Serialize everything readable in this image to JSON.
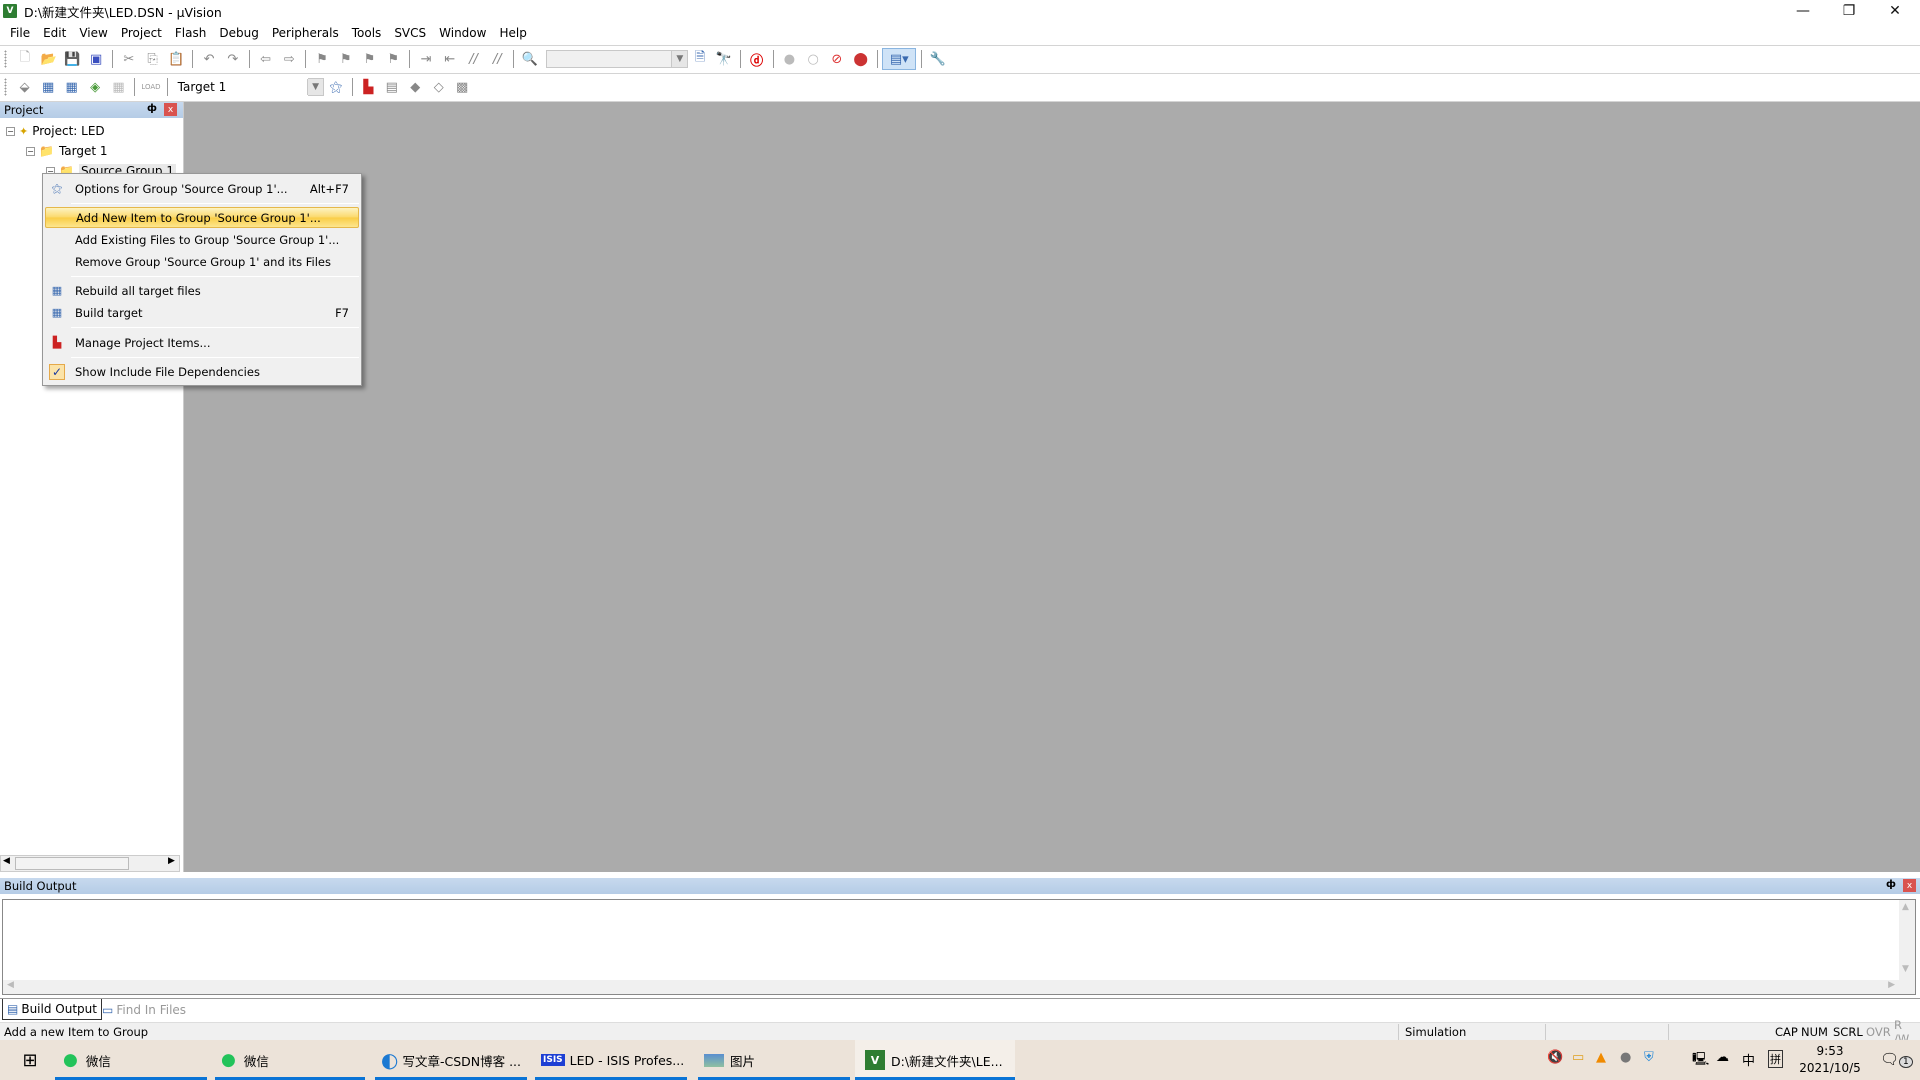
{
  "window": {
    "title": "D:\\新建文件夹\\LED.DSN - µVision",
    "app_icon": "uvision-icon",
    "controls": {
      "minimize": "—",
      "restore": "❐",
      "close": "✕"
    }
  },
  "menubar": [
    "File",
    "Edit",
    "View",
    "Project",
    "Flash",
    "Debug",
    "Peripherals",
    "Tools",
    "SVCS",
    "Window",
    "Help"
  ],
  "toolbar1": {
    "icons": [
      "new-file-icon",
      "open-folder-icon",
      "save-icon",
      "save-all-icon",
      "cut-icon",
      "copy-icon",
      "paste-icon",
      "undo-icon",
      "redo-icon",
      "navigate-back-icon",
      "navigate-forward-icon",
      "bookmark-icon",
      "prev-bookmark-icon",
      "next-bookmark-icon",
      "clear-bookmarks-icon",
      "indent-icon",
      "unindent-icon",
      "comment-icon",
      "uncomment-icon",
      "find-in-files-icon"
    ],
    "find_combo_value": "",
    "icons2": [
      "find-icon",
      "incremental-find-icon",
      "debug-session-icon",
      "breakpoint-icon",
      "disable-breakpoint-icon",
      "disable-all-breakpoints-icon",
      "kill-all-breakpoints-icon",
      "window-layout-icon",
      "configure-icon"
    ]
  },
  "toolbar2": {
    "icons": [
      "translate-icon",
      "build-icon",
      "rebuild-icon",
      "batch-build-icon",
      "stop-build-icon",
      "download-icon"
    ],
    "target_select": "Target 1",
    "icons2": [
      "target-options-icon",
      "manage-project-items-icon",
      "select-packs-icon",
      "manage-rte-icon",
      "event-recorder-icon",
      "pack-installer-icon"
    ]
  },
  "project_panel": {
    "title": "Project",
    "pin": "ф",
    "close": "x",
    "tree": [
      {
        "label": "Project: LED",
        "icon": "project-icon",
        "toggle": "−"
      },
      {
        "label": "Target 1",
        "icon": "target-folder-icon",
        "toggle": "−"
      },
      {
        "label": "Source Group 1",
        "icon": "folder-icon",
        "toggle": "−"
      }
    ]
  },
  "context_menu": {
    "items": [
      {
        "label": "Options for Group 'Source Group 1'...",
        "shortcut": "Alt+F7",
        "icon": "options-wand-icon"
      },
      {
        "label": "Add New  Item to Group 'Source Group 1'...",
        "shortcut": "",
        "highlighted": true
      },
      {
        "label": "Add Existing Files to Group 'Source Group 1'...",
        "shortcut": ""
      },
      {
        "label": "Remove Group 'Source Group 1' and its Files",
        "shortcut": ""
      },
      {
        "label": "Rebuild all target files",
        "shortcut": "",
        "icon": "rebuild-icon"
      },
      {
        "label": "Build target",
        "shortcut": "F7",
        "icon": "build-icon"
      },
      {
        "label": "Manage Project Items...",
        "shortcut": "",
        "icon": "manage-project-items-icon"
      },
      {
        "label": "Show Include File Dependencies",
        "shortcut": "",
        "icon": "checkmark-icon",
        "checked": true
      }
    ]
  },
  "build_output": {
    "title": "Build Output",
    "content": ""
  },
  "bottom_tabs": [
    {
      "label": "Build Output",
      "active": true,
      "icon": "build-output-icon"
    },
    {
      "label": "Find In Files",
      "active": false,
      "icon": "find-in-files-icon"
    }
  ],
  "statusbar": {
    "message": "Add a new Item to Group",
    "mode": "Simulation",
    "indicators": [
      "CAP",
      "NUM",
      "SCRL",
      "OVR",
      "R /W"
    ]
  },
  "taskbar": {
    "items": [
      {
        "label": "微信",
        "icon": "wechat-icon"
      },
      {
        "label": "微信",
        "icon": "wechat-icon"
      },
      {
        "label": "写文章-CSDN博客 ...",
        "icon": "edge-icon"
      },
      {
        "label": "LED - ISIS Profes...",
        "icon": "isis-icon"
      },
      {
        "label": "图片",
        "icon": "photos-icon"
      },
      {
        "label": "D:\\新建文件夹\\LE...",
        "icon": "uvision-icon",
        "active": true
      }
    ],
    "tray": {
      "ime_lang": "中",
      "ime_mode": "拼",
      "time": "9:53",
      "date": "2021/10/5",
      "notifications": "1"
    }
  },
  "colors": {
    "workspace": "#ababab",
    "highlight": "#f9cd45",
    "panel_header": "#b5cce6",
    "taskbar_accent": "#0a74d6"
  }
}
